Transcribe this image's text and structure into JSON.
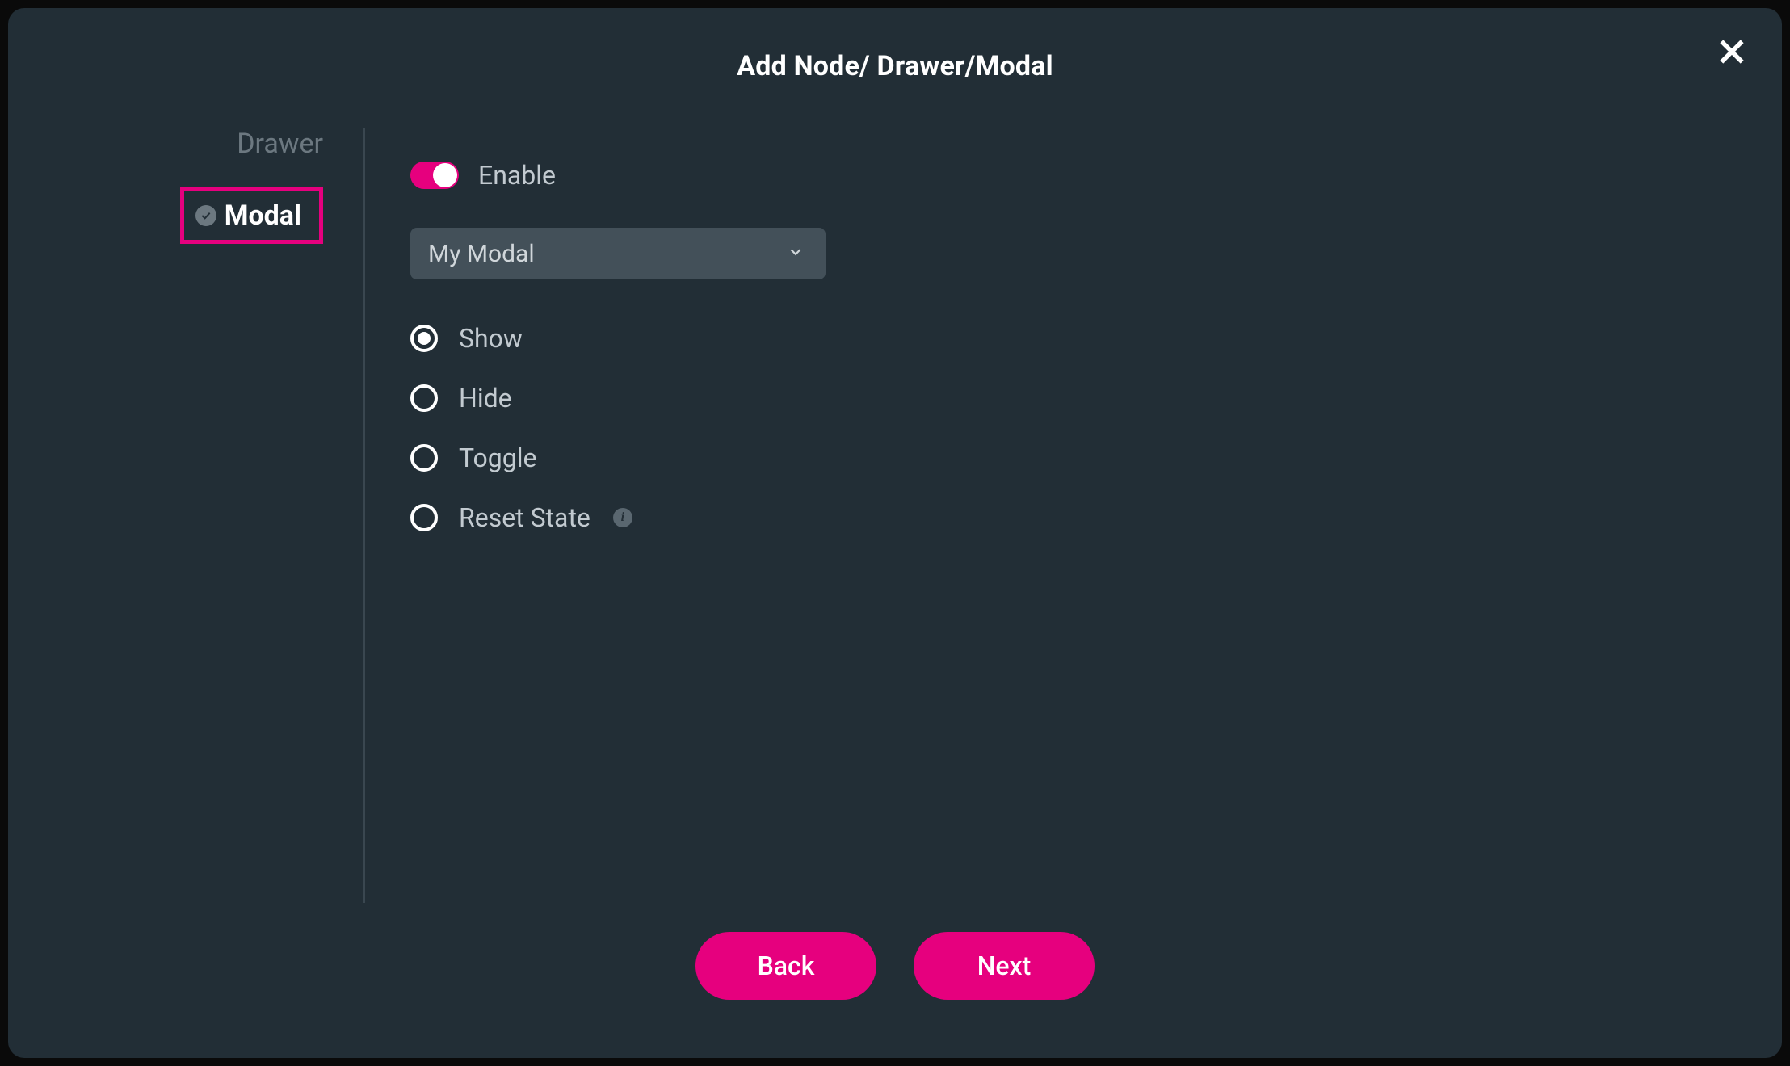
{
  "header": {
    "title": "Add Node/ Drawer/Modal"
  },
  "sidebar": {
    "items": [
      {
        "label": "Drawer",
        "active": false
      },
      {
        "label": "Modal",
        "active": true
      }
    ]
  },
  "content": {
    "toggle": {
      "label": "Enable",
      "enabled": true
    },
    "dropdown": {
      "selected": "My Modal"
    },
    "radio": {
      "options": [
        {
          "label": "Show",
          "selected": true,
          "info": false
        },
        {
          "label": "Hide",
          "selected": false,
          "info": false
        },
        {
          "label": "Toggle",
          "selected": false,
          "info": false
        },
        {
          "label": "Reset State",
          "selected": false,
          "info": true
        }
      ]
    }
  },
  "footer": {
    "back_label": "Back",
    "next_label": "Next"
  }
}
